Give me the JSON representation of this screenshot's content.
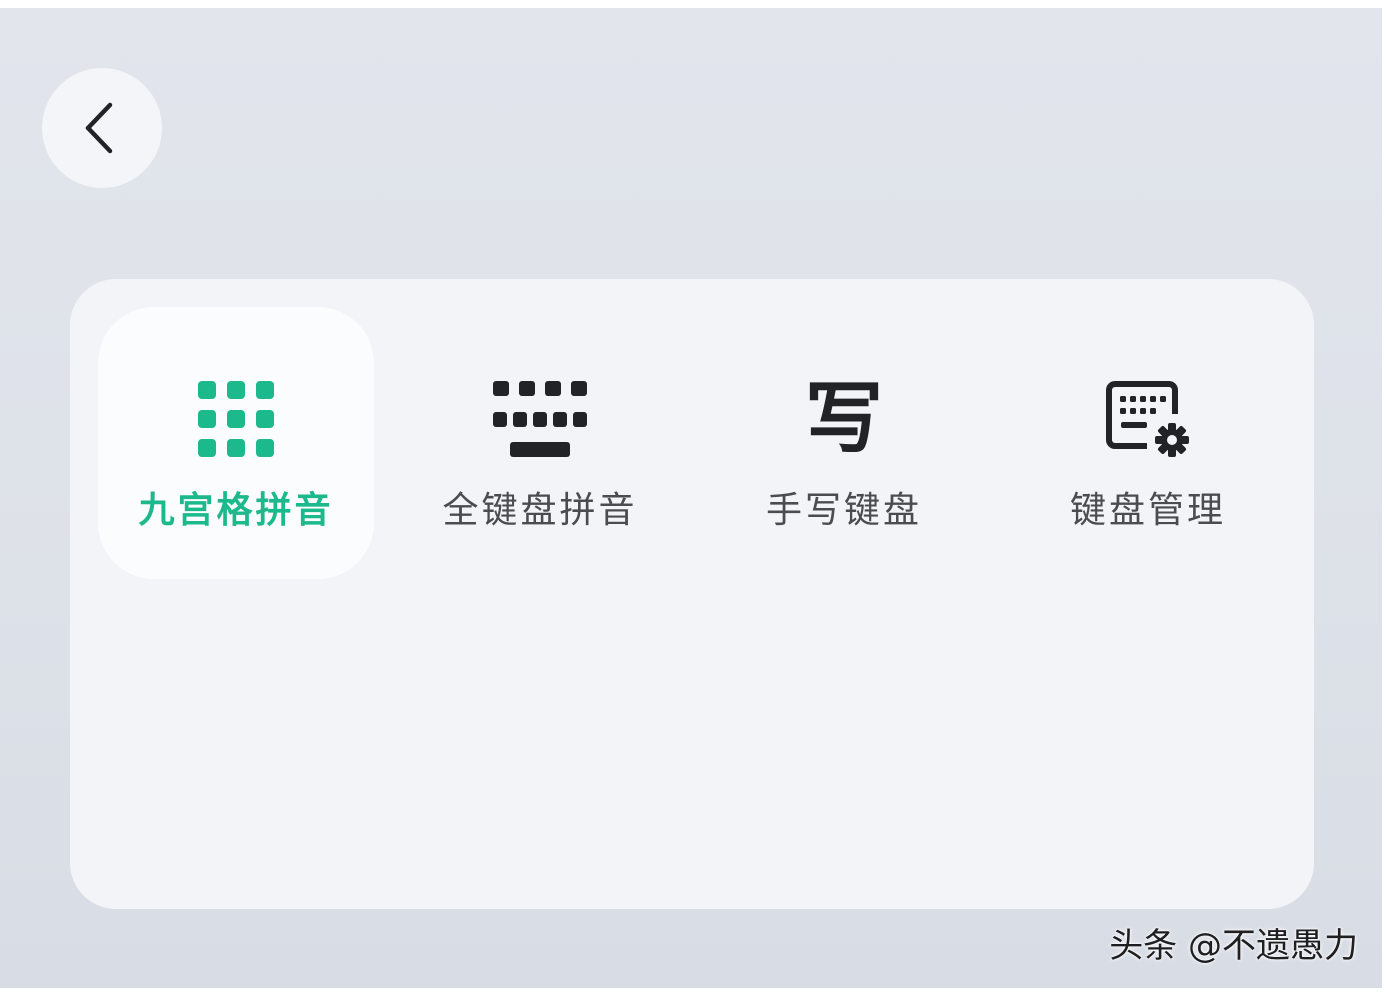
{
  "keyboard_options": [
    {
      "label": "九宫格拼音",
      "icon": "nine-grid-icon",
      "selected": true
    },
    {
      "label": "全键盘拼音",
      "icon": "full-keyboard-icon",
      "selected": false
    },
    {
      "label": "手写键盘",
      "icon": "handwriting-icon",
      "icon_text": "写",
      "selected": false
    },
    {
      "label": "键盘管理",
      "icon": "keyboard-settings-icon",
      "selected": false
    }
  ],
  "back_icon": "chevron-left-icon",
  "colors": {
    "accent": "#1cb98c",
    "text": "#4a4c52",
    "icon": "#222326"
  },
  "watermark": "头条 @不遗愚力"
}
